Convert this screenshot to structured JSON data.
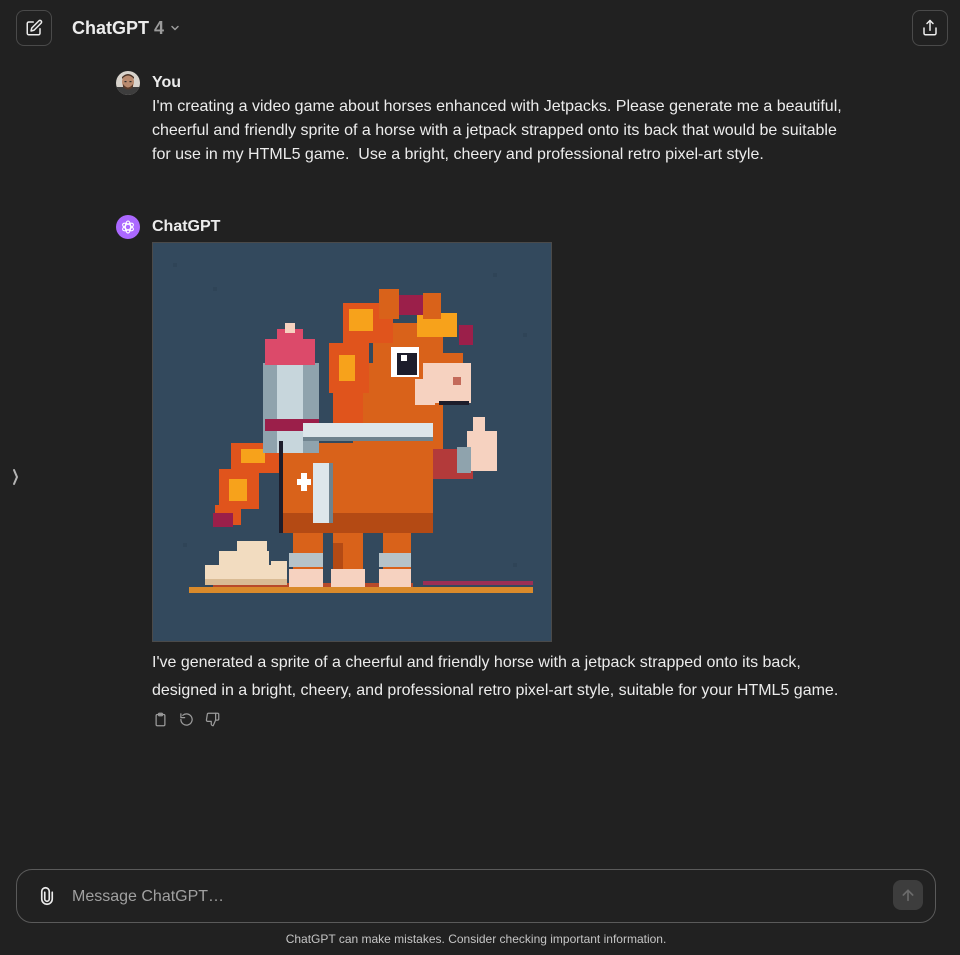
{
  "header": {
    "model_name": "ChatGPT",
    "model_version": "4",
    "new_chat_icon": "edit-icon",
    "share_icon": "share-icon"
  },
  "conversation": {
    "user_message": {
      "author": "You",
      "text": "I'm creating a video game about horses enhanced with Jetpacks. Please generate me a beautiful, cheerful and friendly sprite of a horse with a jetpack strapped onto its back that would be suitable for use in my HTML5 game.  Use a bright, cheery and professional retro pixel-art style."
    },
    "assistant_message": {
      "author": "ChatGPT",
      "text": "I've generated a sprite of a cheerful and friendly horse with a jetpack strapped onto its back, designed in a bright, cheery, and professional retro pixel-art style, suitable for your HTML5 game.",
      "actions": [
        "copy-icon",
        "regenerate-icon",
        "thumbs-down-icon"
      ]
    }
  },
  "composer": {
    "placeholder": "Message ChatGPT…",
    "value": ""
  },
  "footer": {
    "disclaimer": "ChatGPT can make mistakes. Consider checking important information."
  },
  "colors": {
    "background": "#212121",
    "image_background": "#33495d",
    "assistant_avatar": "#ab68ff"
  }
}
